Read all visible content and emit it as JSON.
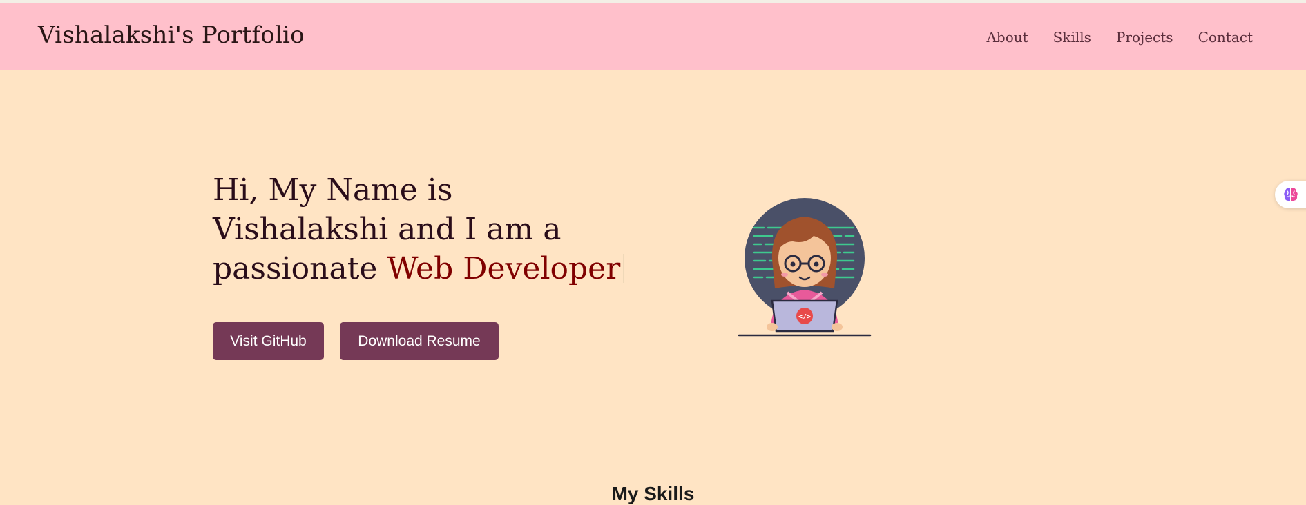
{
  "navbar": {
    "brand": "Vishalakshi's Portfolio",
    "links": [
      {
        "label": "About"
      },
      {
        "label": "Skills"
      },
      {
        "label": "Projects"
      },
      {
        "label": "Contact"
      }
    ]
  },
  "hero": {
    "heading_prefix": "Hi, My Name is Vishalakshi and I am a passionate ",
    "heading_accent": "Web Developer",
    "buttons": {
      "github": "Visit GitHub",
      "resume": "Download Resume"
    },
    "illustration": {
      "icon": "developer-girl-laptop-illustration",
      "laptop_badge_text": "</>"
    }
  },
  "floating_widget": {
    "icon": "brain-icon"
  },
  "skills_section": {
    "title": "My Skills"
  },
  "colors": {
    "background": "#ffe4c4",
    "navbar": "#ffc0cb",
    "button": "#753956",
    "accent": "#800000"
  }
}
